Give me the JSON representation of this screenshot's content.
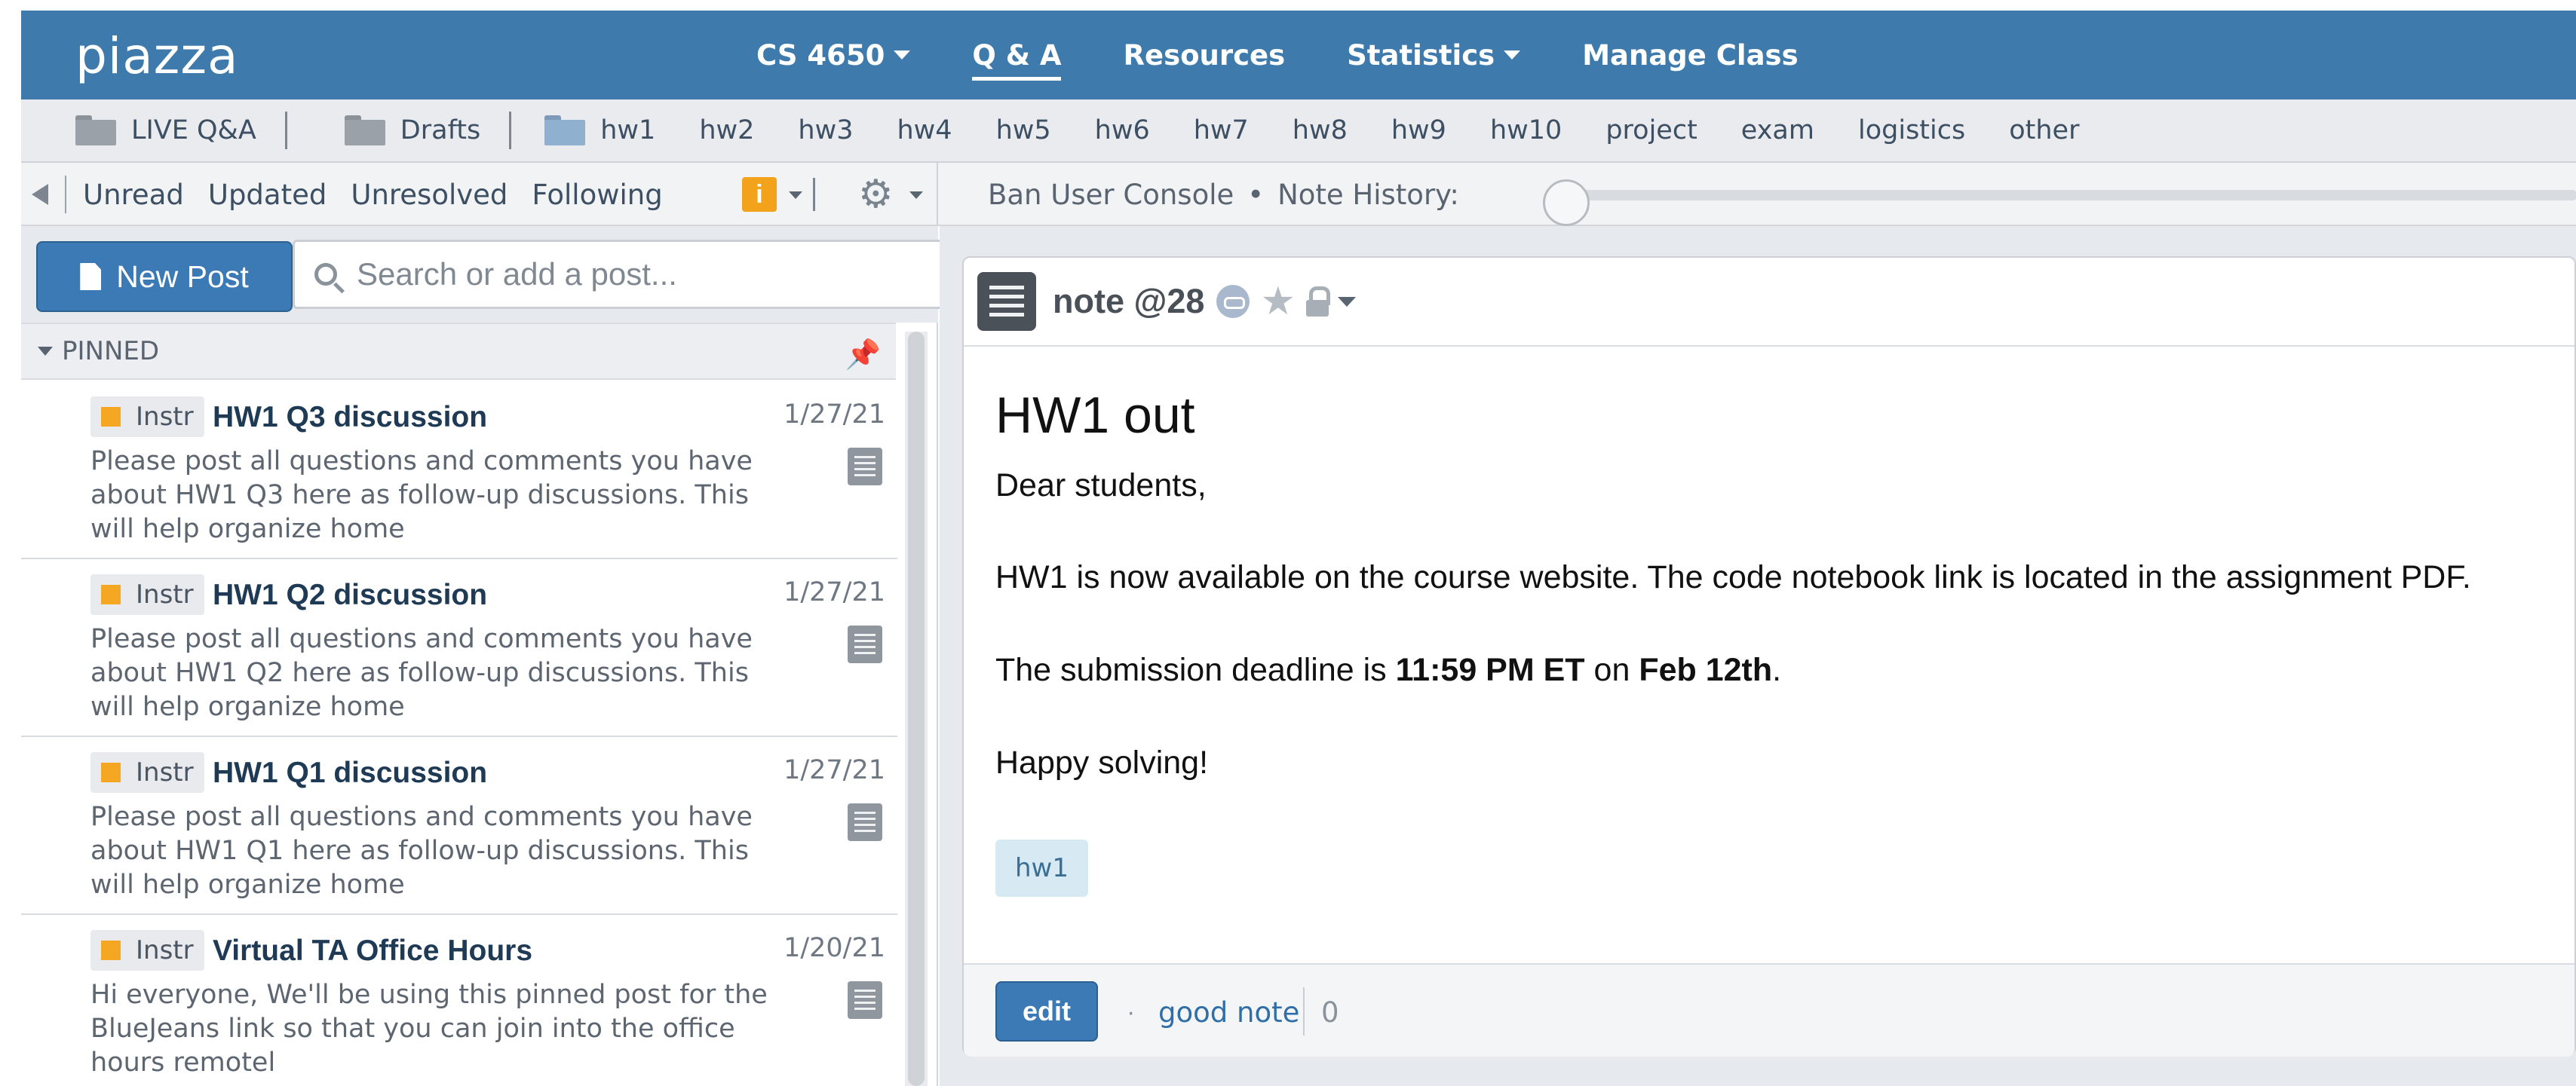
{
  "topbar": {
    "logo": "piazza",
    "nav": [
      {
        "label": "CS 4650",
        "dropdown": true
      },
      {
        "label": "Q & A",
        "active": true
      },
      {
        "label": "Resources"
      },
      {
        "label": "Statistics",
        "dropdown": true
      },
      {
        "label": "Manage Class"
      }
    ]
  },
  "folders": {
    "live": "LIVE Q&A",
    "drafts": "Drafts",
    "items": [
      "hw1",
      "hw2",
      "hw3",
      "hw4",
      "hw5",
      "hw6",
      "hw7",
      "hw8",
      "hw9",
      "hw10",
      "project",
      "exam",
      "logistics",
      "other"
    ]
  },
  "filters": {
    "items": [
      "Unread",
      "Updated",
      "Unresolved",
      "Following"
    ],
    "info_badge": "i",
    "ban_console": "Ban User Console",
    "separator": "•",
    "note_history": "Note History:"
  },
  "left": {
    "new_post": "New Post",
    "search_placeholder": "Search or add a post...",
    "pinned_label": "PINNED",
    "posts": [
      {
        "badge": "Instr",
        "title": "HW1 Q3 discussion",
        "date": "1/27/21",
        "preview": "Please post all questions and comments you have about HW1 Q3 here as follow-up discussions. This will help organize home"
      },
      {
        "badge": "Instr",
        "title": "HW1 Q2 discussion",
        "date": "1/27/21",
        "preview": "Please post all questions and comments you have about HW1 Q2 here as follow-up discussions. This will help organize home"
      },
      {
        "badge": "Instr",
        "title": "HW1 Q1 discussion",
        "date": "1/27/21",
        "preview": "Please post all questions and comments you have about HW1 Q1 here as follow-up discussions. This will help organize home"
      },
      {
        "badge": "Instr",
        "title": "Virtual TA Office Hours",
        "date": "1/20/21",
        "preview": "Hi everyone,   We'll be using this pinned post for the BlueJeans link so that you can join into the office hours remotel"
      }
    ]
  },
  "note": {
    "label": "note @28",
    "title": "HW1 out",
    "greeting": "Dear students,",
    "line1": "HW1 is now available on the course website. The code notebook link is located in the assignment PDF.",
    "deadline_prefix": "The submission deadline is ",
    "deadline_time": "11:59 PM ET",
    "deadline_mid": " on ",
    "deadline_date": "Feb 12th",
    "deadline_suffix": ".",
    "closing": "Happy solving!",
    "tag": "hw1",
    "edit": "edit",
    "foot_dot": "·",
    "good_note": "good note",
    "good_count": "0"
  },
  "colors": {
    "topbar": "#3e7aab",
    "accent": "#3c7ab6",
    "instr_badge": "#f5a623"
  }
}
